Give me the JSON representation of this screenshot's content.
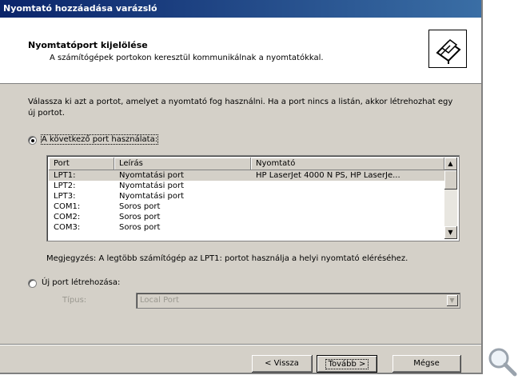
{
  "window": {
    "title": "Nyomtató hozzáadása varázsló"
  },
  "header": {
    "title": "Nyomtatóport kijelölése",
    "subtitle": "A számítógépek portokon keresztül kommunikálnak a nyomtatókkal."
  },
  "intro_text": "Válassza ki azt a portot, amelyet a nyomtató fog használni. Ha a port nincs a listán, akkor létrehozhat egy új portot.",
  "use_existing": {
    "label": "A következő port használata:",
    "checked": true
  },
  "port_list": {
    "columns": [
      "Port",
      "Leírás",
      "Nyomtató"
    ],
    "rows": [
      {
        "port": "LPT1:",
        "description": "Nyomtatási port",
        "printer": "HP LaserJet 4000 N PS, HP LaserJe...",
        "selected": true
      },
      {
        "port": "LPT2:",
        "description": "Nyomtatási port",
        "printer": ""
      },
      {
        "port": "LPT3:",
        "description": "Nyomtatási port",
        "printer": ""
      },
      {
        "port": "COM1:",
        "description": "Soros port",
        "printer": ""
      },
      {
        "port": "COM2:",
        "description": "Soros port",
        "printer": ""
      },
      {
        "port": "COM3:",
        "description": "Soros port",
        "printer": ""
      }
    ]
  },
  "note": "Megjegyzés: A legtöbb számítógép az LPT1: portot használja a helyi nyomtató eléréséhez.",
  "create_new": {
    "label": "Új port létrehozása:",
    "checked": false,
    "type_label": "Típus:",
    "type_value": "Local Port"
  },
  "buttons": {
    "back": "< Vissza",
    "next": "Tovább >",
    "cancel": "Mégse"
  },
  "colors": {
    "titlebar_start": "#0a246a",
    "titlebar_end": "#3a6ea5",
    "dialog_face": "#d4d0c8"
  }
}
